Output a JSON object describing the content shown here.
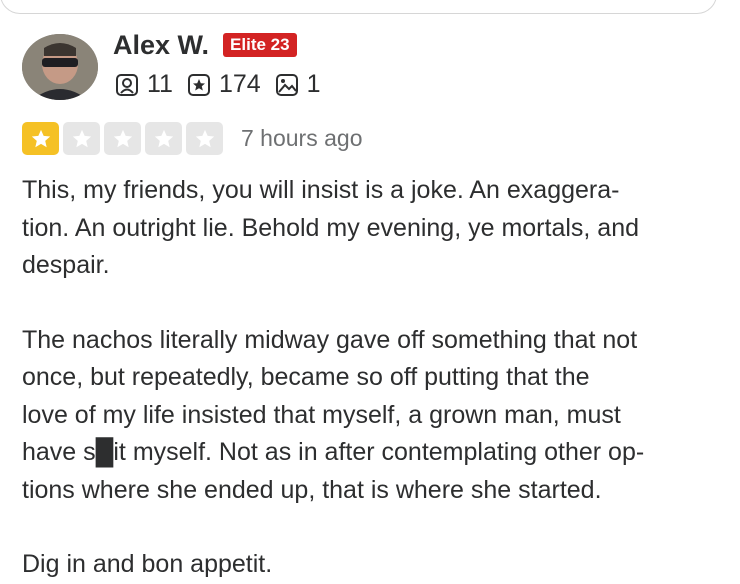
{
  "reviewer": {
    "name": "Alex W.",
    "badge": "Elite 23",
    "friends_count": "11",
    "reviews_count": "174",
    "photos_count": "1",
    "icons": [
      "friends-icon",
      "reviews-icon",
      "photos-icon"
    ]
  },
  "review": {
    "rating": 1,
    "rating_max": 5,
    "time": "7 hours ago",
    "paragraphs": [
      "This, my friends, you will insist is a joke. An exaggera-\ntion. An outright lie. Behold my evening, ye mortals, and\ndespair.",
      "The nachos literally midway gave off something that not\nonce, but repeatedly, became so off putting that the\nlove of my life insisted that myself, a grown man, must\nhave s█it myself. Not as in after contemplating other op-\ntions where she ended up, that is where she started.",
      "Dig in and bon appetit."
    ]
  },
  "colors": {
    "elite_badge": "#d32323",
    "star_filled": "#f5c125",
    "star_empty": "#e6e6e6",
    "text": "#2d2e2f",
    "muted": "#6e7072"
  }
}
